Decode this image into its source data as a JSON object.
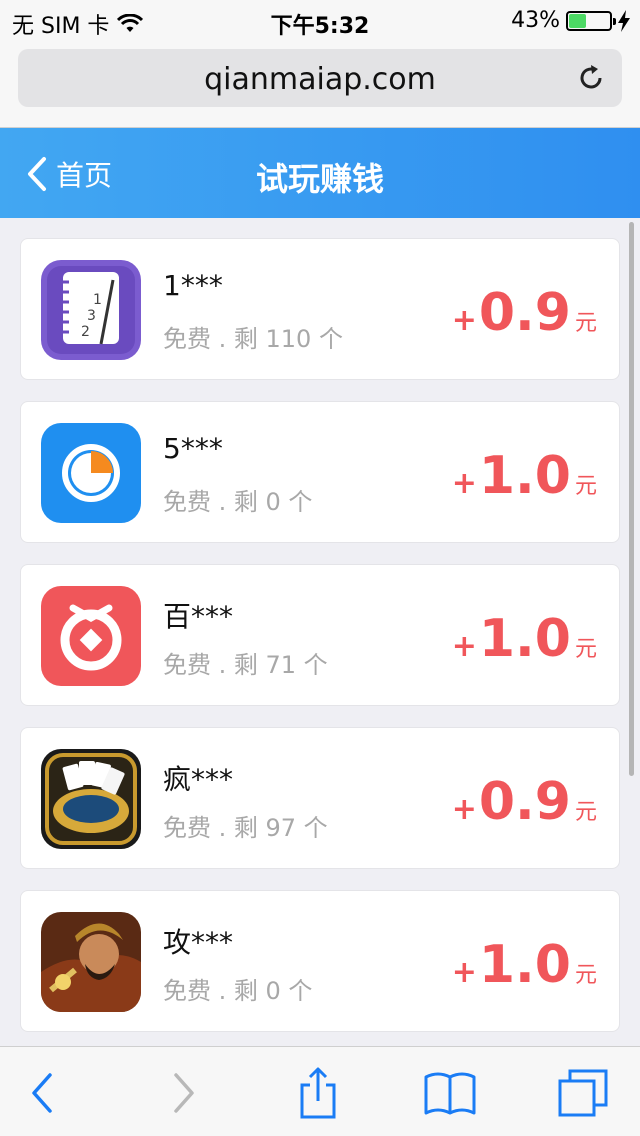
{
  "status_bar": {
    "carrier": "无 SIM 卡",
    "time": "下午5:32",
    "battery_percent": "43%",
    "battery_level": 0.43
  },
  "browser": {
    "url": "qianmaiap.com"
  },
  "header": {
    "back_label": "首页",
    "title": "试玩赚钱"
  },
  "apps": [
    {
      "name": "1***",
      "meta": "免费 . 剩 110 个",
      "plus": "+",
      "value": "0.9",
      "unit": "元",
      "icon": "notebook-icon"
    },
    {
      "name": "5***",
      "meta": "免费 . 剩 0 个",
      "plus": "+",
      "value": "1.0",
      "unit": "元",
      "icon": "pie-timer-icon"
    },
    {
      "name": "百***",
      "meta": "免费 . 剩 71 个",
      "plus": "+",
      "value": "1.0",
      "unit": "元",
      "icon": "coin-ring-icon"
    },
    {
      "name": "疯***",
      "meta": "免费 . 剩 97 个",
      "plus": "+",
      "value": "0.9",
      "unit": "元",
      "icon": "poker-table-icon"
    },
    {
      "name": "攻***",
      "meta": "免费 . 剩 0 个",
      "plus": "+",
      "value": "1.0",
      "unit": "元",
      "icon": "warrior-icon"
    }
  ],
  "colors": {
    "header_blue": "#3b9ef2",
    "reward_red": "#f0565a",
    "toolbar_blue": "#1a7cf5"
  }
}
